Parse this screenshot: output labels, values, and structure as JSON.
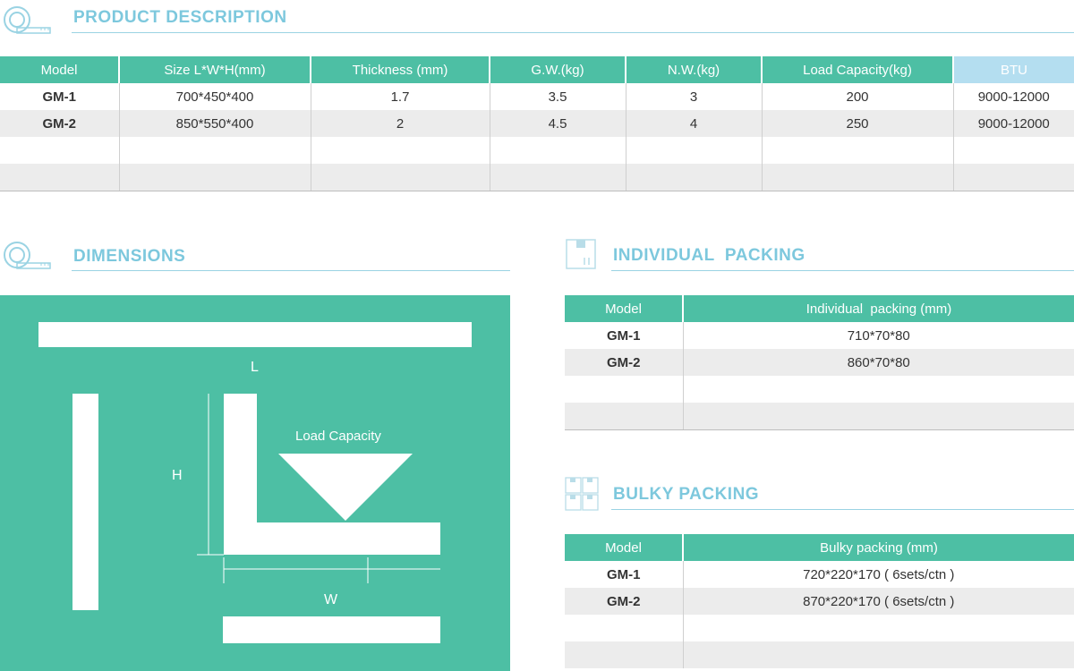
{
  "product_description": {
    "title": "PRODUCT DESCRIPTION",
    "headers": [
      "Model",
      "Size L*W*H(mm)",
      "Thickness (mm)",
      "G.W.(kg)",
      "N.W.(kg)",
      "Load Capacity(kg)",
      "BTU"
    ],
    "rows": [
      [
        "GM-1",
        "700*450*400",
        "1.7",
        "3.5",
        "3",
        "200",
        "9000-12000"
      ],
      [
        "GM-2",
        "850*550*400",
        "2",
        "4.5",
        "4",
        "250",
        "9000-12000"
      ],
      [
        "",
        "",
        "",
        "",
        "",
        "",
        ""
      ],
      [
        "",
        "",
        "",
        "",
        "",
        "",
        ""
      ]
    ]
  },
  "dimensions": {
    "title": "DIMENSIONS",
    "label_l": "L",
    "label_h": "H",
    "label_w": "W",
    "label_load": "Load Capacity"
  },
  "individual_packing": {
    "title": "INDIVIDUAL  PACKING",
    "headers": [
      "Model",
      "Individual  packing (mm)"
    ],
    "rows": [
      [
        "GM-1",
        "710*70*80"
      ],
      [
        "GM-2",
        "860*70*80"
      ],
      [
        "",
        ""
      ],
      [
        "",
        ""
      ]
    ]
  },
  "bulky_packing": {
    "title": "BULKY PACKING",
    "headers": [
      "Model",
      "Bulky packing (mm)"
    ],
    "rows": [
      [
        "GM-1",
        "720*220*170 ( 6sets/ctn )"
      ],
      [
        "GM-2",
        "870*220*170 ( 6sets/ctn )"
      ],
      [
        "",
        ""
      ],
      [
        "",
        ""
      ]
    ]
  },
  "colors": {
    "teal": "#4dbfa4",
    "light_blue": "#7dc8dd",
    "btu_header": "#b4def0",
    "row_gray": "#ececec"
  }
}
